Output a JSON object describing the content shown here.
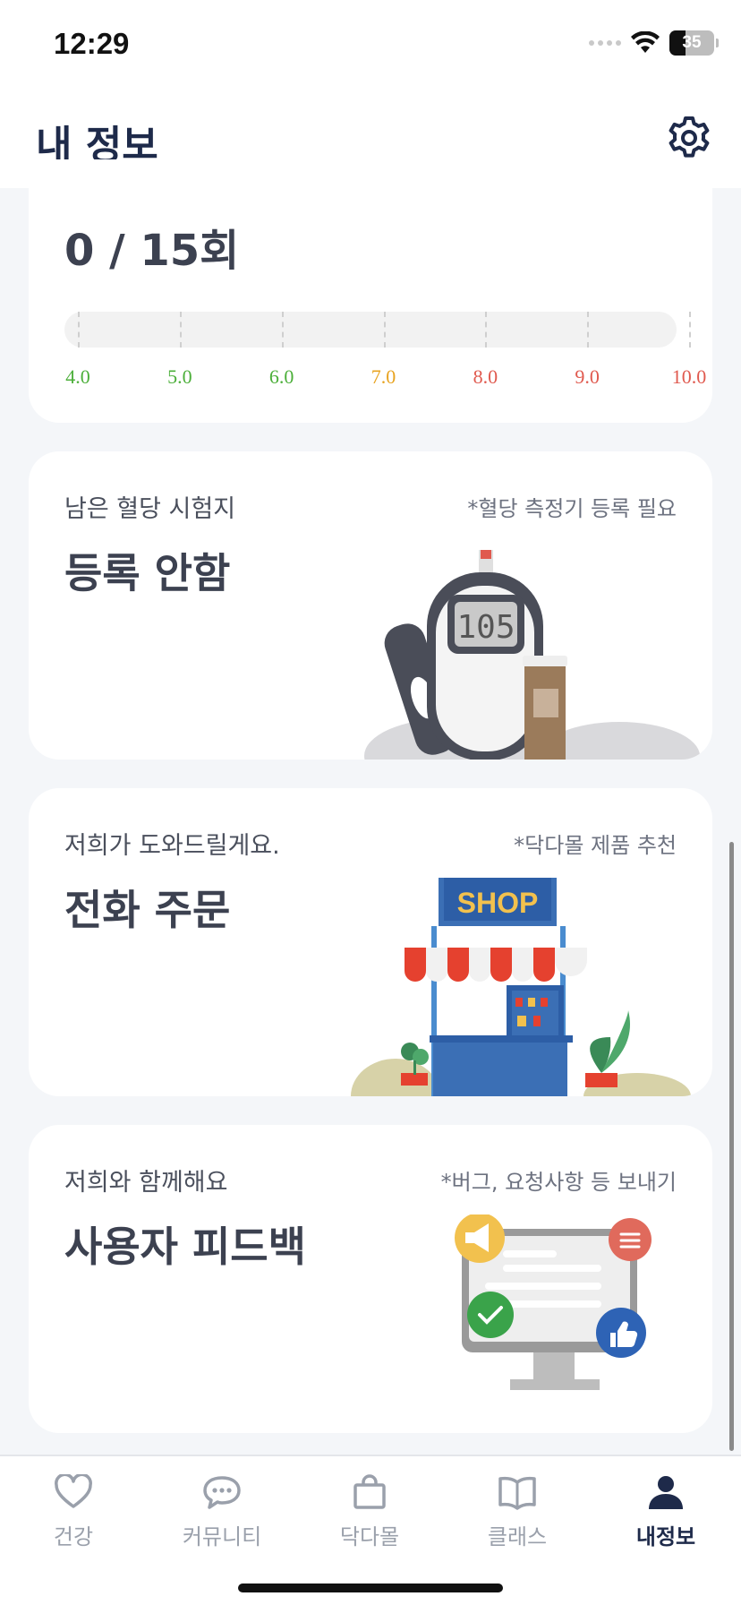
{
  "status_bar": {
    "time": "12:29",
    "battery": "35",
    "battery_level": 0.35,
    "icons": [
      "signal-icon",
      "wifi-icon",
      "battery-icon"
    ]
  },
  "header": {
    "title": "내 정보",
    "settings_icon": "gear-icon"
  },
  "glucose_card": {
    "count": "0 / 15회",
    "scale": [
      {
        "label": "4.0",
        "color": "#4caf3a"
      },
      {
        "label": "5.0",
        "color": "#4caf3a"
      },
      {
        "label": "6.0",
        "color": "#4caf3a"
      },
      {
        "label": "7.0",
        "color": "#e8a320"
      },
      {
        "label": "8.0",
        "color": "#e05a4f"
      },
      {
        "label": "9.0",
        "color": "#e05a4f"
      },
      {
        "label": "10.0",
        "color": "#e05a4f"
      }
    ]
  },
  "strips_card": {
    "label": "남은 혈당 시험지",
    "note": "*혈당 측정기 등록 필요",
    "value": "등록 안함",
    "meter_reading": "105",
    "icon": "glucose-meter-icon"
  },
  "order_card": {
    "label": "저희가 도와드릴게요.",
    "note": "*닥다몰 제품 추천",
    "title": "전화 주문",
    "shop_sign": "SHOP",
    "icon": "shop-icon"
  },
  "feedback_card": {
    "label": "저희와 함께해요",
    "note": "*버그, 요청사항 등 보내기",
    "title": "사용자 피드백",
    "icon": "feedback-monitor-icon"
  },
  "tabs": [
    {
      "label": "건강",
      "icon": "heart-icon",
      "active": false
    },
    {
      "label": "커뮤니티",
      "icon": "chat-bubble-icon",
      "active": false
    },
    {
      "label": "닥다몰",
      "icon": "shopping-bag-icon",
      "active": false
    },
    {
      "label": "클래스",
      "icon": "book-icon",
      "active": false
    },
    {
      "label": "내정보",
      "icon": "person-icon",
      "active": true
    }
  ],
  "colors": {
    "title": "#1e2a4a",
    "text": "#3c4150",
    "inactive_tab": "#9aa0ab",
    "background": "#f4f6f9"
  }
}
